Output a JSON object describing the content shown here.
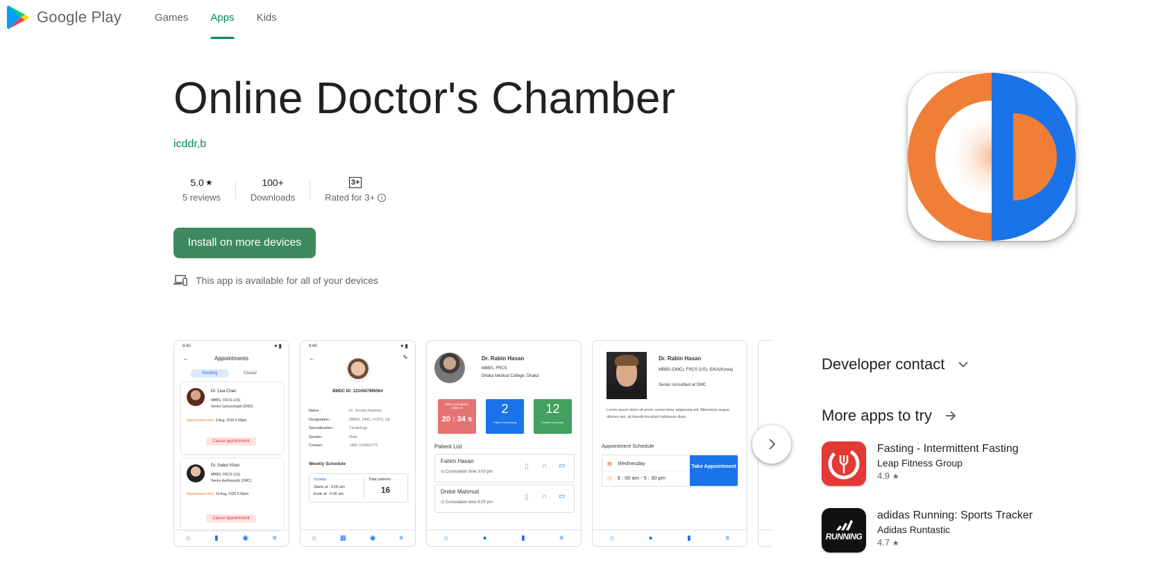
{
  "nav": {
    "brand": "Google Play",
    "tabs": [
      "Games",
      "Apps",
      "Kids"
    ],
    "active_tab": "Apps"
  },
  "app": {
    "title": "Online Doctor's Chamber",
    "developer": "icddr,b",
    "rating": "5.0",
    "rating_star": "★",
    "reviews": "5 reviews",
    "downloads": "100+",
    "downloads_label": "Downloads",
    "content_rating_badge": "3+",
    "content_rating_label": "Rated for 3+",
    "install_label": "Install on more devices",
    "availability": "This app is available for all of your devices"
  },
  "screenshots": {
    "s1": {
      "time": "9:40",
      "title": "Appointments",
      "tab_pending": "Pending",
      "tab_closed": "Closed",
      "cards": [
        {
          "name": "Dr. Lisa Chan",
          "deg": "MBBS, FRCS (US)",
          "role": "Senior Gynocologist (DMC)",
          "time_label": "Appointment time:",
          "time": "2 Aug, 2020 5:30pm",
          "cancel": "Cancel appointment"
        },
        {
          "name": "Dr. Sabur Khan",
          "deg": "MBBS, FRCS (US)",
          "role": "Senior Aurthopedic (DMC)",
          "time_label": "Appointment time:",
          "time": "10 Aug, 2020 5:30pm",
          "cancel": "Cancel appointment"
        }
      ]
    },
    "s2": {
      "time": "9:40",
      "bmdc": "BMDC ID: 1234567896564",
      "rows": [
        {
          "k": "Name :",
          "v": "Dr. Shebla Radwan"
        },
        {
          "k": "Designation :",
          "v": "MBBS, DMC, FCPS, UK"
        },
        {
          "k": "Specialization :",
          "v": "Cardiology"
        },
        {
          "k": "Gender :",
          "v": "Male"
        },
        {
          "k": "Contact :",
          "v": "+880 154466776"
        }
      ],
      "weekly": "Weekly Schedule",
      "day": "Sunday",
      "starts": "Starts at : 9:00 am",
      "ends": "Ends at : 6:00 am",
      "total_label": "Total patients",
      "total": "16"
    },
    "s3": {
      "name": "Dr. Rabin Hasan",
      "deg": "MBBS, FRCS",
      "inst": "Dhaka Medical College, Dhaka",
      "next_label": "Next consultation starts in",
      "next_time": "20 : 34 s",
      "remaining": "2",
      "remaining_label": "Patient Remaining",
      "consulted": "12",
      "consulted_label": "Patient Consulted",
      "list_title": "Patient List",
      "patients": [
        {
          "name": "Fahim Hasan",
          "time": "Consulation time 3:00 pm"
        },
        {
          "name": "Drebir Mahmud",
          "time": "Consulation time 6:00 pm"
        }
      ]
    },
    "s4": {
      "name": "Dr. Rabin Hasan",
      "deg": "MBBS (DMC), FRCS (US), IDKA(Korea)",
      "role": "Senior consultant at DMC",
      "lorem": "Lorem ipsum dolor sit amet, consectetur adipiscing elit. Bibendum augue ultrices nisi, sit blandit tincidunt habitasse diam.",
      "sched_title": "Appointment Schedule",
      "day": "Wednesday",
      "hours": "9 : 00 am - 5 : 30 pm",
      "take": "Take Appointment"
    }
  },
  "sidebar": {
    "developer_contact": "Developer contact",
    "more_apps": "More apps to try",
    "apps": [
      {
        "name": "Fasting - Intermittent Fasting",
        "dev": "Leap Fitness Group",
        "rating": "4.9",
        "star": "★",
        "color": "#e53935"
      },
      {
        "name": "adidas Running: Sports Tracker",
        "dev": "Adidas Runtastic",
        "rating": "4.7",
        "star": "★",
        "color": "#111111",
        "icon_text": "RUNNING"
      }
    ]
  },
  "colors": {
    "accent": "#01875f",
    "orange": "#ef7f36",
    "blue": "#1a73e8"
  }
}
